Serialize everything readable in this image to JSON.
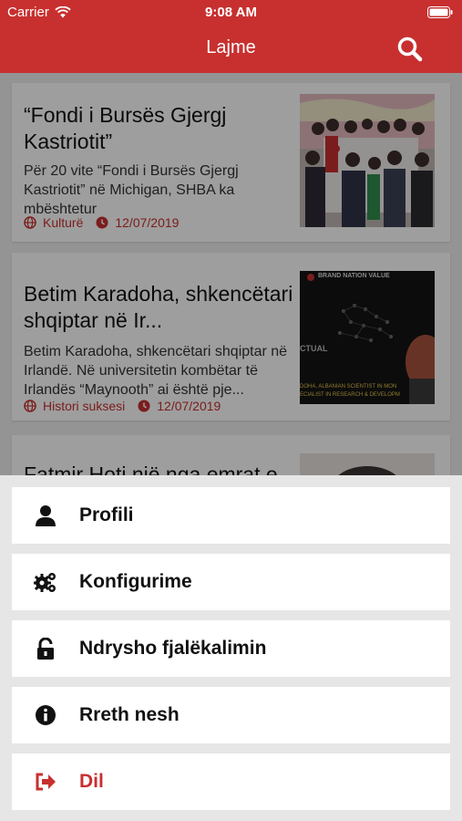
{
  "status": {
    "carrier": "Carrier",
    "time": "9:08 AM"
  },
  "header": {
    "title": "Lajme"
  },
  "articles": [
    {
      "title": "“Fondi i Bursës Gjergj Kastriotit”",
      "desc": "Për 20 vite “Fondi i Bursës Gjergj Kastriotit” në Michigan, SHBA ka mbështetur",
      "category": "Kulturë",
      "date": "12/07/2019"
    },
    {
      "title": "Betim Karadoha, shkencëtari shqiptar në Ir...",
      "desc": "Betim Karadoha, shkencëtari shqiptar në Irlandë. Në universitetin kombëtar të Irlandës “Maynooth” ai është pje...",
      "category": "Histori suksesi",
      "date": "12/07/2019",
      "thumb_banner": "BRAND NATION VALUE",
      "thumb_word": "CTUAL",
      "thumb_caption_1": "DOHA, ALBANIAN SCIENTIST IN MON",
      "thumb_caption_2": "ECIALIST IN RESEARCH & DEVELOPM"
    },
    {
      "title": "Fatmir Hoti një nga emrat e"
    }
  ],
  "menu": [
    {
      "label": "Profili",
      "icon": "user-icon"
    },
    {
      "label": "Konfigurime",
      "icon": "gears-icon"
    },
    {
      "label": "Ndrysho fjalëkalimin",
      "icon": "unlock-icon"
    },
    {
      "label": "Rreth nesh",
      "icon": "info-icon"
    },
    {
      "label": "Dil",
      "icon": "sign-out-icon"
    }
  ],
  "colors": {
    "brand": "#c7302f",
    "overlay": "rgba(0,0,0,0.38)"
  }
}
